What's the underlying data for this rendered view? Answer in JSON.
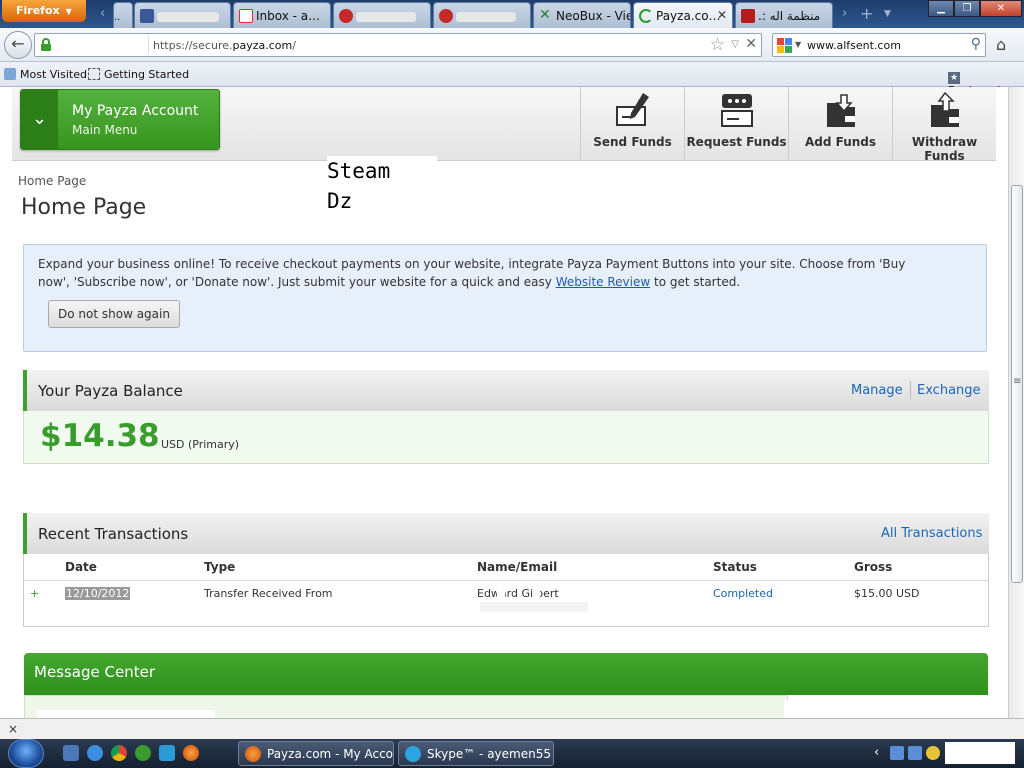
{
  "browser": {
    "menu_label": "Firefox",
    "tabs": [
      {
        "label": "Facebook",
        "icon": "facebook-icon",
        "color": "#3b5998"
      },
      {
        "label": "Inbox - a…",
        "icon": "gmail-icon",
        "color": "#d93025"
      },
      {
        "label": "",
        "icon": "tab-icon",
        "color": "#c62828"
      },
      {
        "label": "",
        "icon": "tab-icon",
        "color": "#c62828"
      },
      {
        "label": "NeoBux - Vie…",
        "icon": "neobux-icon",
        "color": "#2e7d32"
      },
      {
        "label": "Payza.co…",
        "icon": "loading-icon",
        "color": "#2e9b2e",
        "active": true
      },
      {
        "label": ".: منظمة اله",
        "icon": "tux-icon",
        "color": "#b71c1c"
      }
    ],
    "url_prefix": "https://secure.",
    "url_domain": "payza.com",
    "url_suffix": "/",
    "search_text": "www.alfsent.com",
    "bookmarks": [
      "Most Visited",
      "Getting Started"
    ],
    "bookmarks_menu": "Bookmarks"
  },
  "header": {
    "menu_title": "My Payza Account",
    "menu_subtitle": "Main Menu",
    "actions": [
      {
        "label": "Send Funds",
        "icon": "send-funds-icon"
      },
      {
        "label": "Request Funds",
        "icon": "request-funds-icon"
      },
      {
        "label": "Add Funds",
        "icon": "add-funds-icon"
      },
      {
        "label": "Withdraw Funds",
        "icon": "withdraw-funds-icon"
      }
    ]
  },
  "overlay": {
    "line1": "Steam",
    "line2": "Dz"
  },
  "breadcrumb": "Home Page",
  "page_title": "Home Page",
  "promo": {
    "text_before": "Expand your business online! To receive checkout payments on your website, integrate Payza Payment Buttons into your site. Choose from 'Buy now', 'Subscribe now', or 'Donate now'. Just submit your website for a quick and easy ",
    "link": "Website Review",
    "text_after": " to get started.",
    "dismiss": "Do not show again"
  },
  "balance": {
    "title": "Your Payza Balance",
    "manage": "Manage",
    "exchange": "Exchange",
    "amount": "$14.38",
    "currency": "USD (Primary)"
  },
  "transactions": {
    "title": "Recent Transactions",
    "all_link": "All Transactions",
    "columns": [
      "Date",
      "Type",
      "Name/Email",
      "Status",
      "Gross"
    ],
    "rows": [
      {
        "expand": "+",
        "date": "12/10/2012",
        "type": "Transfer Received From",
        "name": "Edward Gilbert",
        "status": "Completed",
        "gross": "$15.00 USD"
      }
    ]
  },
  "message_center": {
    "title": "Message Center"
  },
  "statusbar": {
    "close": "×"
  },
  "taskbar": {
    "tasks": [
      {
        "label": "Payza.com - My Accou…",
        "icon": "firefox-icon"
      },
      {
        "label": "Skype™ - ayemen55",
        "icon": "skype-icon"
      }
    ]
  },
  "colors": {
    "brand_green": "#3a9c2c",
    "link_blue": "#1b66b8",
    "promo_bg": "#e7f0fa"
  }
}
